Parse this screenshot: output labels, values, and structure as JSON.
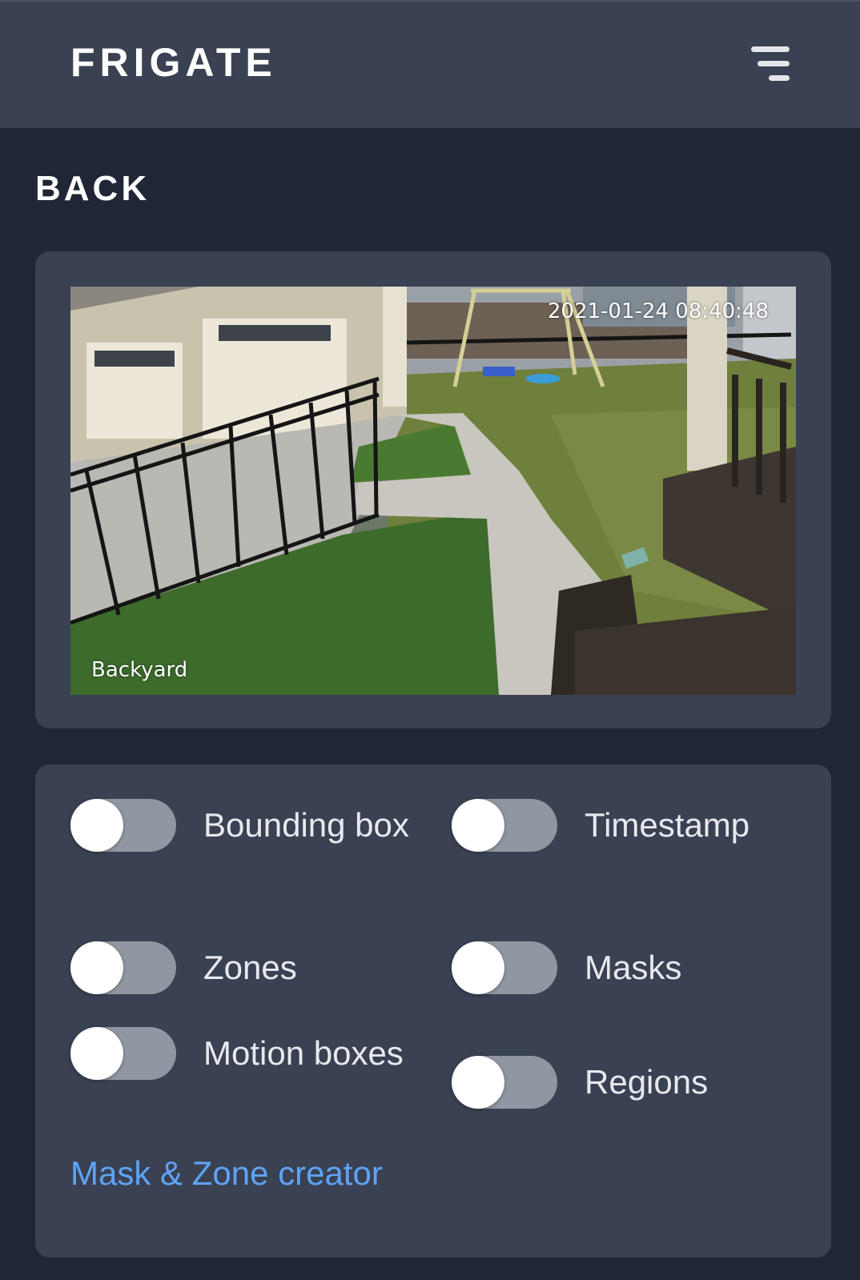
{
  "header": {
    "app_title": "FRIGATE",
    "menu_icon": "hamburger-menu-icon"
  },
  "page": {
    "title": "BACK"
  },
  "camera": {
    "timestamp": "2021-01-24 08:40:48",
    "name": "Backyard"
  },
  "toggles": [
    {
      "label": "Bounding box",
      "checked": false
    },
    {
      "label": "Timestamp",
      "checked": false
    },
    {
      "label": "Zones",
      "checked": false
    },
    {
      "label": "Masks",
      "checked": false
    },
    {
      "label": "Motion boxes",
      "checked": false
    },
    {
      "label": "Regions",
      "checked": false
    }
  ],
  "link": {
    "mask_zone_creator": "Mask & Zone creator"
  },
  "colors": {
    "background": "#1f2737",
    "card": "#394152",
    "toggle_track": "#9096a2",
    "link": "#5fa3f5"
  }
}
